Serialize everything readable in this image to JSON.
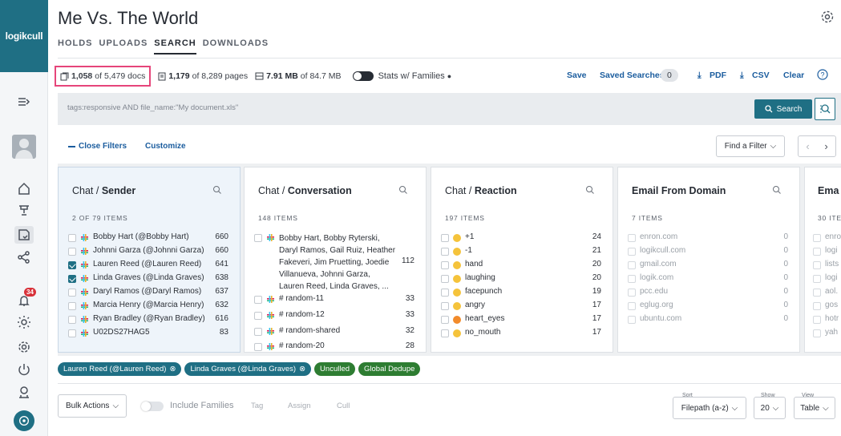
{
  "app": {
    "logo": "logikcull",
    "title": "Me Vs. The World"
  },
  "nav": {
    "tabs": [
      "HOLDS",
      "UPLOADS",
      "SEARCH",
      "DOWNLOADS"
    ],
    "active": "SEARCH"
  },
  "stats": {
    "docs_count": "1,058",
    "docs_total": "of 5,479 docs",
    "pages_count": "1,179",
    "pages_total": "of 8,289 pages",
    "size_value": "7.91 MB",
    "size_total": "of 84.7 MB",
    "families_label": "Stats w/ Families"
  },
  "actions": {
    "save": "Save",
    "saved_searches": "Saved Searches",
    "saved_count": "0",
    "pdf": "PDF",
    "csv": "CSV",
    "clear": "Clear"
  },
  "search": {
    "query": "tags:responsive AND file_name:\"My document.xls\"",
    "button": "Search"
  },
  "filters_bar": {
    "close": "Close Filters",
    "customize": "Customize",
    "find": "Find a Filter"
  },
  "cards": [
    {
      "prefix": "Chat / ",
      "title": "Sender",
      "count": "2 OF 79 ITEMS",
      "rows": [
        {
          "label": "Bobby Hart (@Bobby Hart)",
          "count": "660",
          "checked": false
        },
        {
          "label": "Johnni Garza (@Johnni Garza)",
          "count": "660",
          "checked": false
        },
        {
          "label": "Lauren Reed (@Lauren Reed)",
          "count": "641",
          "checked": true
        },
        {
          "label": "Linda Graves (@Linda Graves)",
          "count": "638",
          "checked": true
        },
        {
          "label": "Daryl Ramos (@Daryl Ramos)",
          "count": "637",
          "checked": false
        },
        {
          "label": "Marcia Henry (@Marcia Henry)",
          "count": "632",
          "checked": false
        },
        {
          "label": "Ryan Bradley (@Ryan Bradley)",
          "count": "616",
          "checked": false
        },
        {
          "label": "U02DS27HAG5",
          "count": "83",
          "checked": false
        }
      ]
    },
    {
      "prefix": "Chat / ",
      "title": "Conversation",
      "count": "148 ITEMS",
      "multi": {
        "label": "Bobby Hart, Bobby Ryterski, Daryl Ramos, Gail Ruiz, Heather Fakeveri, Jim Pruetting, Joedie Villanueva, Johnni Garza, Lauren Reed, Linda Graves, ...",
        "count": "112"
      },
      "rows": [
        {
          "label": "# random-11",
          "count": "33"
        },
        {
          "label": "# random-12",
          "count": "33"
        },
        {
          "label": "# random-shared",
          "count": "32"
        },
        {
          "label": "# random-20",
          "count": "28"
        }
      ]
    },
    {
      "prefix": "Chat / ",
      "title": "Reaction",
      "count": "197 ITEMS",
      "rows": [
        {
          "label": "+1",
          "count": "24",
          "emoji": "thumbs-up"
        },
        {
          "label": "-1",
          "count": "21",
          "emoji": "thumbs-down"
        },
        {
          "label": "hand",
          "count": "20",
          "emoji": "hand"
        },
        {
          "label": "laughing",
          "count": "20",
          "emoji": "laughing"
        },
        {
          "label": "facepunch",
          "count": "19",
          "emoji": "facepunch"
        },
        {
          "label": "angry",
          "count": "17",
          "emoji": "angry"
        },
        {
          "label": "heart_eyes",
          "count": "17",
          "emoji": "heart-eyes"
        },
        {
          "label": "no_mouth",
          "count": "17",
          "emoji": "no-mouth"
        }
      ]
    },
    {
      "prefix": "",
      "title": "Email From Domain",
      "count": "7 ITEMS",
      "rows": [
        {
          "label": "enron.com",
          "count": "0"
        },
        {
          "label": "logikcull.com",
          "count": "0"
        },
        {
          "label": "gmail.com",
          "count": "0"
        },
        {
          "label": "logik.com",
          "count": "0"
        },
        {
          "label": "pcc.edu",
          "count": "0"
        },
        {
          "label": "eglug.org",
          "count": "0"
        },
        {
          "label": "ubuntu.com",
          "count": "0"
        }
      ]
    },
    {
      "prefix": "",
      "title": "Ema",
      "count": "30 ITE",
      "rows": [
        {
          "label": "enro"
        },
        {
          "label": "logi"
        },
        {
          "label": "lists"
        },
        {
          "label": "logi"
        },
        {
          "label": "aol."
        },
        {
          "label": "gos"
        },
        {
          "label": "hotr"
        },
        {
          "label": "yah"
        }
      ]
    }
  ],
  "chips": [
    {
      "label": "Lauren Reed (@Lauren Reed)",
      "style": "blue"
    },
    {
      "label": "Linda Graves (@Linda Graves)",
      "style": "blue"
    },
    {
      "label": "Unculled",
      "style": "green"
    },
    {
      "label": "Global Dedupe",
      "style": "green"
    }
  ],
  "bottom": {
    "bulk": "Bulk Actions",
    "include_families": "Include Families",
    "tag": "Tag",
    "assign": "Assign",
    "cull": "Cull",
    "sort_label": "Sort",
    "sort_value": "Filepath (a-z)",
    "show_label": "Show",
    "show_value": "20",
    "view_label": "View",
    "view_value": "Table"
  },
  "colors": {
    "brand": "#1f6f84",
    "link": "#1a5c9e",
    "highlight": "#e6457a",
    "green": "#2e7d32",
    "badge": "#d8323a"
  },
  "sidebar_badge": "34"
}
